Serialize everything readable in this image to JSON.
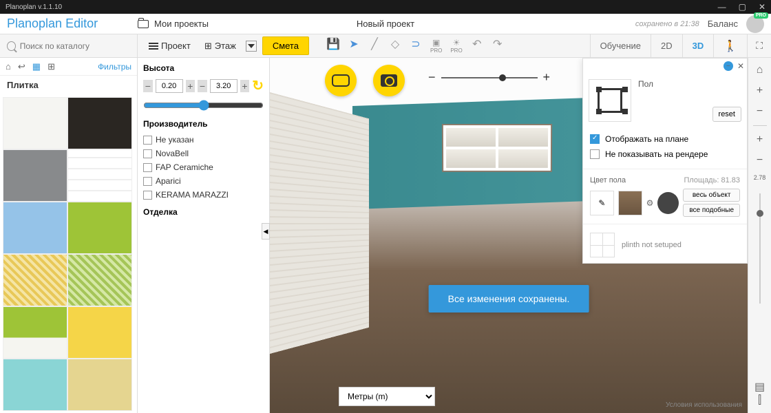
{
  "titlebar": {
    "title": "Planoplan v.1.1.10"
  },
  "header": {
    "logo": "Planoplan Editor",
    "my_projects": "Мои проекты",
    "project_title": "Новый проект",
    "saved_at": "сохранено в 21:38",
    "balance": "Баланс",
    "pro": "PRO"
  },
  "search": {
    "placeholder": "Поиск по каталогу"
  },
  "toolbar": {
    "project": "Проект",
    "floor": "Этаж",
    "estimate": "Смета",
    "training": "Обучение",
    "view_2d": "2D",
    "view_3d": "3D"
  },
  "sidebar": {
    "filters": "Фильтры",
    "category": "Плитка"
  },
  "filter_panel": {
    "height_label": "Высота",
    "height_min": "0.20",
    "height_max": "3.20",
    "manufacturer_label": "Производитель",
    "manufacturers": [
      "Не указан",
      "NovaBell",
      "FAP Ceramiche",
      "Aparici",
      "KERAMA MARAZZI"
    ],
    "finish_label": "Отделка"
  },
  "viewport": {
    "toast": "Все изменения сохранены.",
    "units": "Метры (m)",
    "terms": "Условия использования"
  },
  "properties": {
    "name": "Пол",
    "reset": "reset",
    "show_on_plan": "Отображать на плане",
    "hide_on_render": "Не показывать на рендере",
    "floor_color": "Цвет пола",
    "area_label": "Площадь:",
    "area_value": "81.83",
    "whole_object": "весь объект",
    "all_similar": "все подобные",
    "plinth": "plinth not setuped"
  },
  "rail": {
    "zoom_value": "2.78"
  }
}
